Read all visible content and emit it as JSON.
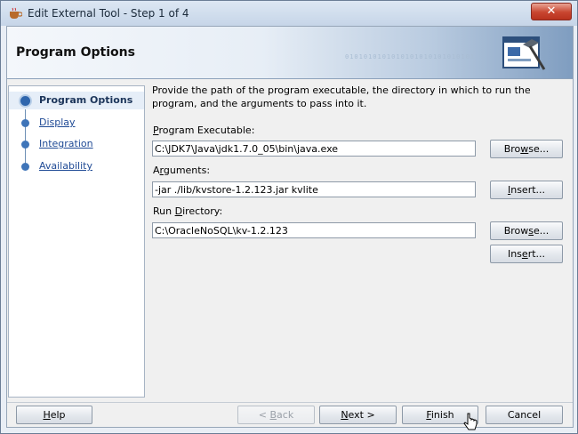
{
  "window": {
    "title": "Edit External Tool - Step 1 of 4",
    "close_label": "✕"
  },
  "banner": {
    "title": "Program Options",
    "binary_text": "0101010101010101010101010101"
  },
  "nav": {
    "items": [
      {
        "label": "Program Options",
        "selected": true
      },
      {
        "label": "Display"
      },
      {
        "label": "Integration"
      },
      {
        "label": "Availability"
      }
    ]
  },
  "main": {
    "description": "Provide the path of the program executable, the directory in which to run the program, and the arguments to pass into it.",
    "program_executable": {
      "label_pre": "",
      "label_u": "P",
      "label_post": "rogram Executable:",
      "value": "C:\\JDK7\\Java\\jdk1.7.0_05\\bin\\java.exe",
      "button_pre": "Bro",
      "button_u": "w",
      "button_post": "se..."
    },
    "arguments": {
      "label_pre": "A",
      "label_u": "r",
      "label_post": "guments:",
      "value": "-jar ./lib/kvstore-1.2.123.jar kvlite",
      "button_pre": "",
      "button_u": "I",
      "button_post": "nsert..."
    },
    "run_directory": {
      "label_pre": "Run ",
      "label_u": "D",
      "label_post": "irectory:",
      "value": "C:\\OracleNoSQL\\kv-1.2.123",
      "button_pre": "Brow",
      "button_u": "s",
      "button_post": "e...",
      "insert_pre": "Ins",
      "insert_u": "e",
      "insert_post": "rt..."
    }
  },
  "footer": {
    "help_pre": "",
    "help_u": "H",
    "help_post": "elp",
    "back_pre": "< ",
    "back_u": "B",
    "back_post": "ack",
    "next_pre": "",
    "next_u": "N",
    "next_post": "ext >",
    "finish_pre": "",
    "finish_u": "F",
    "finish_post": "inish",
    "cancel": "Cancel"
  }
}
